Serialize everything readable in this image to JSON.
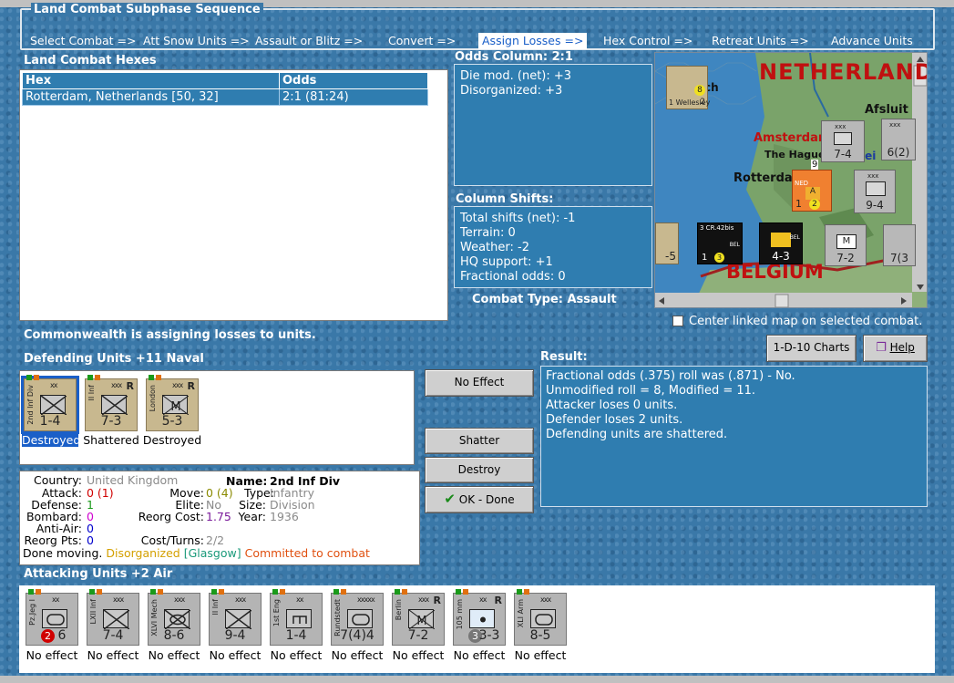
{
  "sequence": {
    "title": "Land Combat Subphase Sequence",
    "steps": [
      "Select Combat =>",
      "Att Snow Units =>",
      "Assault or Blitz =>",
      "Convert =>",
      "Assign Losses =>",
      "Hex Control =>",
      "Retreat Units =>",
      "Advance Units"
    ]
  },
  "hexes": {
    "title": "Land Combat Hexes",
    "columns": [
      "Hex",
      "Odds"
    ],
    "rows": [
      {
        "hex": "Rotterdam, Netherlands [50, 32]",
        "odds": "2:1 (81:24)"
      }
    ]
  },
  "odds": {
    "title": "Odds Column: 2:1",
    "lines": [
      "Die mod. (net): +3",
      "Disorganized: +3"
    ]
  },
  "shifts": {
    "title": "Column Shifts:",
    "lines": [
      "Total shifts (net): -1",
      "Terrain: 0",
      "Weather: -2",
      "HQ support: +1",
      "Fractional odds: 0"
    ]
  },
  "combat_type": "Combat Type:  Assault",
  "map": {
    "labels": [
      "NETHERLANDS",
      "BELGIUM",
      "Amsterdam",
      "The Hague",
      "Rotterdam",
      "Afsluit",
      "ch",
      "lei"
    ],
    "counters": [
      {
        "side": "1 Wellesley",
        "value": "8",
        "sub": "2"
      },
      {
        "side": "XXII Inf",
        "size": "xxx",
        "value": "7-4"
      },
      {
        "side": "XXXIX Pz",
        "size": "xxx",
        "value": "6(2)"
      },
      {
        "side": "NED",
        "value": "1",
        "sub": "2",
        "flag": "A",
        "badge": "9"
      },
      {
        "side": "2nd Inf",
        "size": "xxx",
        "value": "9-4"
      },
      {
        "side": "3 CR.42bis",
        "value": "1",
        "sub": "3",
        "note": "BEL"
      },
      {
        "side": "II Inf",
        "value": "4-3",
        "note": "BEL"
      },
      {
        "side": "Berlin",
        "value": "7-2"
      },
      {
        "side": "XXXIX Mot",
        "value": "7(3"
      },
      {
        "side": "",
        "value": "-5"
      }
    ]
  },
  "link_map": "Center linked map on selected combat.",
  "status": "Commonwealth is assigning losses to units.",
  "defenders": {
    "title": "Defending Units +11 Naval",
    "units": [
      {
        "side": "2nd Inf Div",
        "size": "xx",
        "value": "1-4",
        "type": "inf",
        "caption": "Destroyed",
        "selected": true
      },
      {
        "side": "II Inf",
        "size": "xxx",
        "value": "7-3",
        "type": "inf",
        "caption": "Shattered",
        "r": "R"
      },
      {
        "side": "London",
        "size": "xxx",
        "value": "5-3",
        "type": "mil",
        "caption": "Destroyed",
        "r": "R"
      }
    ]
  },
  "buttons": {
    "no_effect": "No Effect",
    "shatter": "Shatter",
    "destroy": "Destroy",
    "ok": "OK - Done",
    "charts": "1-D-10 Charts",
    "help": "Help"
  },
  "result": {
    "title": "Result:",
    "lines": [
      "Fractional odds (.375) roll was (.871)  - No.",
      "Unmodified roll = 8, Modified = 11.",
      "Attacker loses 0 units.",
      "Defender loses 2 units.",
      "Defending units are shattered."
    ]
  },
  "unit_info": {
    "country_label": "Country:",
    "country": "United Kingdom",
    "name_label": "Name:",
    "name": "2nd Inf Div",
    "attack_label": "Attack:",
    "attack": "0 (1)",
    "move_label": "Move:",
    "move": "0 (4)",
    "type_label": "Type:",
    "type": "Infantry",
    "defense_label": "Defense:",
    "defense": "1",
    "elite_label": "Elite:",
    "elite": "No",
    "size_label": "Size:",
    "size": "Division",
    "bombard_label": "Bombard:",
    "bombard": "0",
    "reorg_cost_label": "Reorg Cost:",
    "reorg_cost": "1.75",
    "year_label": "Year:",
    "year": "1936",
    "antiair_label": "Anti-Air:",
    "antiair": "0",
    "reorg_pts_label": "Reorg Pts:",
    "reorg_pts": "0",
    "cost_turns_label": "Cost/Turns:",
    "cost_turns": "2/2",
    "done_label": "Done moving.",
    "disorg": "Disorganized",
    "glasgow": "[Glasgow]",
    "committed": "Committed to combat"
  },
  "attackers": {
    "title": "Attacking Units +2 Air",
    "units": [
      {
        "side": "Pz.Jeg I",
        "size": "xx",
        "value": "6",
        "badge": "2",
        "type": "arm",
        "caption": "No effect"
      },
      {
        "side": "LXII Inf",
        "size": "xxx",
        "value": "7-4",
        "type": "inf",
        "caption": "No effect"
      },
      {
        "side": "XLVI Mech",
        "size": "xxx",
        "value": "8-6",
        "type": "mech",
        "caption": "No effect"
      },
      {
        "side": "II Inf",
        "size": "xxx",
        "value": "9-4",
        "type": "inf",
        "caption": "No effect"
      },
      {
        "side": "1st Eng",
        "size": "xx",
        "value": "1-4",
        "type": "eng",
        "caption": "No effect"
      },
      {
        "side": "Rundstedt",
        "size": "xxxxx",
        "value": "7(4)4",
        "type": "hq",
        "caption": "No effect"
      },
      {
        "side": "Berlin",
        "size": "xxx",
        "value": "7-2",
        "type": "mil",
        "caption": "No effect",
        "r": "R"
      },
      {
        "side": "105 mm",
        "size": "xx",
        "value": "3-3",
        "badge": "3",
        "type": "art",
        "caption": "No effect",
        "r": "R"
      },
      {
        "side": "XLI Arm",
        "size": "xxx",
        "value": "8-5",
        "type": "arm2",
        "caption": "No effect"
      }
    ]
  },
  "colors": {
    "panel_blue": "#2f7db0",
    "selected": "#1a5fc8",
    "attack_red": "#d00000",
    "defense_green": "#1a9a1a",
    "pink": "#d000d0",
    "blue": "#0000cc",
    "orange": "#d4a000"
  }
}
